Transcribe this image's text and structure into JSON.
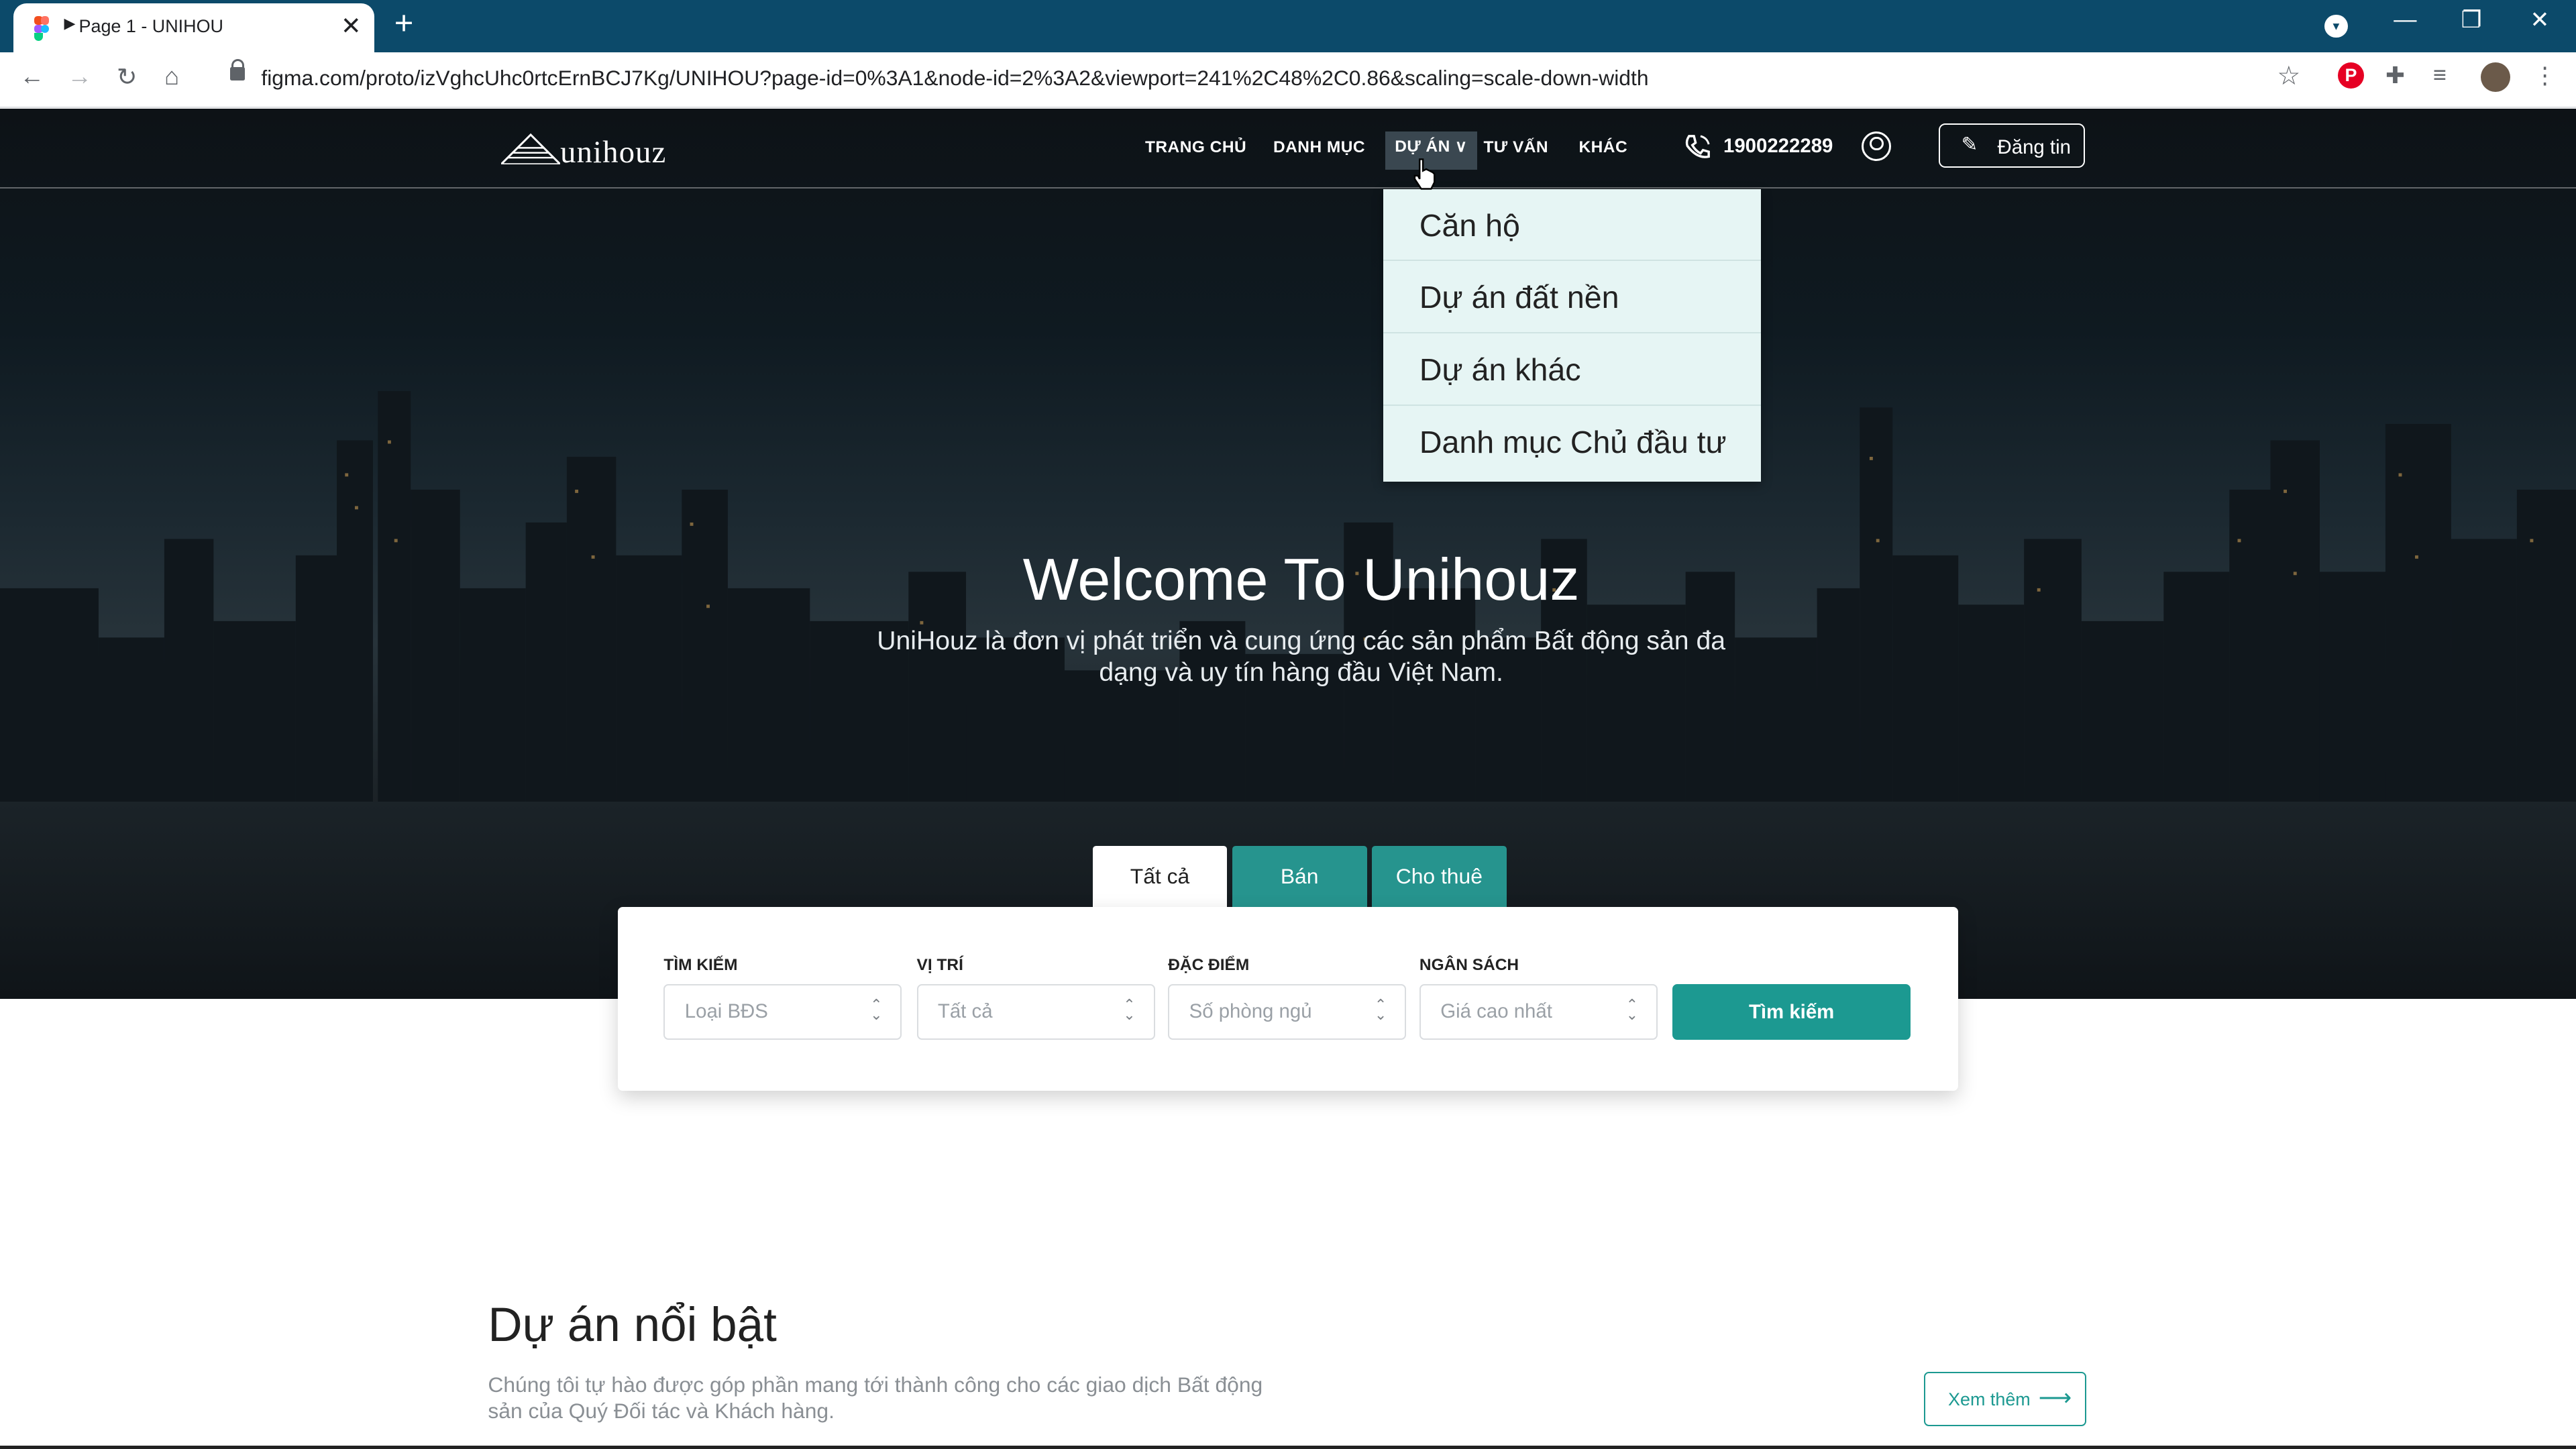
{
  "browser": {
    "tab_title": "Page 1 - UNIHOU",
    "url": "figma.com/proto/izVghcUhc0rtcErnBCJ7Kg/UNIHOU?page-id=0%3A1&node-id=2%3A2&viewport=241%2C48%2C0.86&scaling=scale-down-width"
  },
  "nav": {
    "logo_text": "unihouz",
    "links": [
      "TRANG CHỦ",
      "DANH MỤC",
      "DỰ ÁN",
      "TƯ VẤN",
      "KHÁC"
    ],
    "phone": "1900222289",
    "post_label": "Đăng tin"
  },
  "dropdown": {
    "items": [
      "Căn hộ",
      "Dự án đất nền",
      "Dự án khác",
      "Danh mục Chủ đầu tư"
    ]
  },
  "hero": {
    "title": "Welcome To Unihouz",
    "subtitle": "UniHouz là đơn vị phát triển và cung ứng các sản phẩm Bất động sản đa dạng và uy tín hàng đầu Việt Nam."
  },
  "search": {
    "tabs": [
      "Tất cả",
      "Bán",
      "Cho thuê"
    ],
    "fields": [
      {
        "label": "TÌM KIẾM",
        "value": "Loại BĐS"
      },
      {
        "label": "VỊ TRÍ",
        "value": "Tất cả"
      },
      {
        "label": "ĐẶC ĐIỂM",
        "value": "Số phòng ngủ"
      },
      {
        "label": "NGÂN SÁCH",
        "value": "Giá cao nhất"
      }
    ],
    "button": "Tìm kiếm"
  },
  "featured": {
    "title": "Dự án nổi bật",
    "description": "Chúng tôi tự hào được góp phần mang tới thành công cho các giao dịch Bất động sản của Quý Đối tác và Khách hàng.",
    "more_label": "Xem thêm"
  },
  "colors": {
    "brand_teal": "#1c9991",
    "tab_teal": "#26948e",
    "chrome_blue": "#0c4a6a",
    "dropdown_bg": "#e6f5f4"
  }
}
